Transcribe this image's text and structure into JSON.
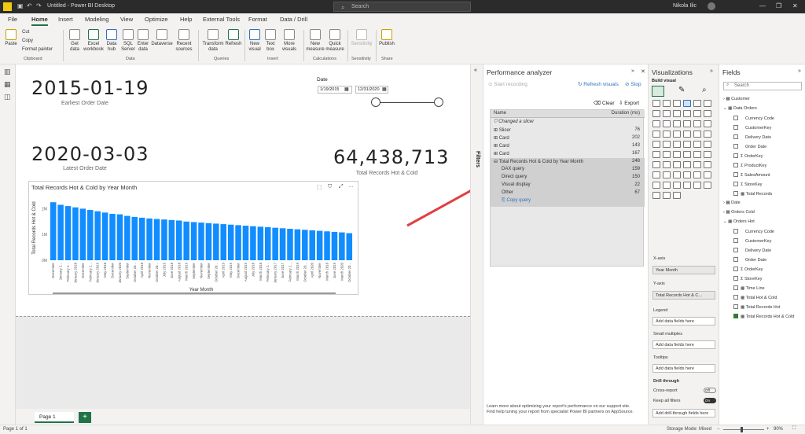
{
  "window": {
    "title": "Untitled - Power BI Desktop",
    "search": "Search",
    "user": "Nikola Ilic"
  },
  "tabs": [
    "File",
    "Home",
    "Insert",
    "Modeling",
    "View",
    "Optimize",
    "Help",
    "External Tools",
    "Format",
    "Data / Drill"
  ],
  "ribbon": {
    "clipboard": {
      "paste": "Paste",
      "cut": "Cut",
      "copy": "Copy",
      "format_painter": "Format painter",
      "group": "Clipboard"
    },
    "data": {
      "get_data": "Get data",
      "excel": "Excel workbook",
      "data_hub": "Data hub",
      "sql": "SQL Server",
      "enter": "Enter data",
      "dataverse": "Dataverse",
      "recent": "Recent sources",
      "group": "Data"
    },
    "queries": {
      "transform": "Transform data",
      "refresh": "Refresh",
      "group": "Queries"
    },
    "insert": {
      "new_visual": "New visual",
      "text_box": "Text box",
      "more_visuals": "More visuals",
      "group": "Insert"
    },
    "calculations": {
      "new_measure": "New measure",
      "quick_measure": "Quick measure",
      "group": "Calculations"
    },
    "sensitivity": {
      "label": "Sensitivity",
      "group": "Sensitivity"
    },
    "share": {
      "publish": "Publish",
      "group": "Share"
    }
  },
  "canvas": {
    "earliest": {
      "value": "2015-01-19",
      "label": "Earliest Order Date"
    },
    "latest": {
      "value": "2020-03-03",
      "label": "Latest Order Date"
    },
    "total": {
      "value": "64,438,713",
      "label": "Total Records Hot & Cold"
    },
    "slicer": {
      "title": "Date",
      "from": "1/19/2015",
      "to": "12/31/2020"
    }
  },
  "chart_data": {
    "type": "bar",
    "title": "Total Records Hot & Cold by Year Month",
    "xlabel": "Year Month",
    "ylabel": "Total Records Hot & Cold",
    "yticks": [
      "0M",
      "1M",
      "2M"
    ],
    "ylim": [
      0,
      2.5
    ],
    "categories": [
      "December",
      "January 2...",
      "February 2...",
      "January 2018",
      "December",
      "February 2...",
      "January 2019",
      "May 2018",
      "December",
      "January 2020",
      "September",
      "October 20...",
      "April 2018",
      "November",
      "October 20...",
      "July 2019",
      "June 2018",
      "August 2018",
      "March 2019",
      "September",
      "November",
      "September",
      "October 20...",
      "April 2019",
      "May 2019",
      "December",
      "August 2019",
      "July 2018",
      "March 2018",
      "February 2...",
      "January 2017",
      "June 2017",
      "February 2...",
      "March 2019",
      "October 20...",
      "April 2020",
      "November",
      "March 2018",
      "June 2019",
      "March 2020",
      "October 20..."
    ],
    "values": [
      2.25,
      2.15,
      2.1,
      2.05,
      2.0,
      1.95,
      1.9,
      1.85,
      1.8,
      1.78,
      1.72,
      1.68,
      1.65,
      1.62,
      1.6,
      1.58,
      1.56,
      1.54,
      1.5,
      1.48,
      1.46,
      1.44,
      1.42,
      1.4,
      1.38,
      1.36,
      1.34,
      1.32,
      1.3,
      1.28,
      1.26,
      1.24,
      1.22,
      1.2,
      1.18,
      1.16,
      1.14,
      1.12,
      1.1,
      1.08,
      1.05
    ]
  },
  "page": {
    "tab": "Page 1",
    "status": "Page 1 of 1",
    "storage": "Storage Mode: Mixed",
    "zoom": "90%"
  },
  "filters_label": "Filters",
  "perf": {
    "title": "Performance analyzer",
    "start": "Start recording",
    "refresh": "Refresh visuals",
    "stop": "Stop",
    "clear": "Clear",
    "export": "Export",
    "col_name": "Name",
    "col_dur": "Duration (ms)",
    "rows": [
      {
        "name": "Changed a slicer",
        "dur": ""
      },
      {
        "name": "Slicer",
        "dur": "76"
      },
      {
        "name": "Card",
        "dur": "202"
      },
      {
        "name": "Card",
        "dur": "143"
      },
      {
        "name": "Card",
        "dur": "167"
      },
      {
        "name": "Total Records Hot & Cold by Year Month",
        "dur": "248"
      },
      {
        "name": "DAX query",
        "dur": "159"
      },
      {
        "name": "Direct query",
        "dur": "150"
      },
      {
        "name": "Visual display",
        "dur": "22"
      },
      {
        "name": "Other",
        "dur": "67"
      },
      {
        "name": "Copy query",
        "dur": ""
      }
    ],
    "footer1": "Learn more about optimizing your report's performance on our support site.",
    "footer2": "Find help tuning your report from specialist Power BI partners on AppSource."
  },
  "viz": {
    "title": "Visualizations",
    "build": "Build visual",
    "xaxis": "X-axis",
    "xval": "Year Month",
    "yaxis": "Y-axis",
    "yval": "Total Records Hot & C...",
    "legend": "Legend",
    "legend_ph": "Add data fields here",
    "small": "Small multiples",
    "small_ph": "Add data fields here",
    "tooltips": "Tooltips",
    "tooltips_ph": "Add data fields here",
    "drill": "Drill through",
    "cross": "Cross-report",
    "cross_state": "Off",
    "keep": "Keep all filters",
    "keep_state": "On",
    "drill_ph": "Add drill-through fields here"
  },
  "fields": {
    "title": "Fields",
    "search": "Search",
    "items": [
      {
        "t": "Customer",
        "lvl": 0,
        "k": "tbl"
      },
      {
        "t": "Data Orders",
        "lvl": 0,
        "k": "tbl"
      },
      {
        "t": "Currency Code",
        "lvl": 1,
        "k": "f"
      },
      {
        "t": "CustomerKey",
        "lvl": 1,
        "k": "f"
      },
      {
        "t": "Delivery Date",
        "lvl": 1,
        "k": "f"
      },
      {
        "t": "Order Date",
        "lvl": 1,
        "k": "f"
      },
      {
        "t": "OrderKey",
        "lvl": 1,
        "k": "s"
      },
      {
        "t": "ProductKey",
        "lvl": 1,
        "k": "s"
      },
      {
        "t": "SalesAmount",
        "lvl": 1,
        "k": "s"
      },
      {
        "t": "StoreKey",
        "lvl": 1,
        "k": "s"
      },
      {
        "t": "Total Records",
        "lvl": 1,
        "k": "m"
      },
      {
        "t": "Date",
        "lvl": 0,
        "k": "tbl"
      },
      {
        "t": "Orders Cold",
        "lvl": 0,
        "k": "tbl"
      },
      {
        "t": "Orders Hot",
        "lvl": 0,
        "k": "tbl"
      },
      {
        "t": "Currency Code",
        "lvl": 1,
        "k": "f"
      },
      {
        "t": "CustomerKey",
        "lvl": 1,
        "k": "f"
      },
      {
        "t": "Delivery Date",
        "lvl": 1,
        "k": "f"
      },
      {
        "t": "Order Date",
        "lvl": 1,
        "k": "f"
      },
      {
        "t": "OrderKey",
        "lvl": 1,
        "k": "s"
      },
      {
        "t": "StoreKey",
        "lvl": 1,
        "k": "s"
      },
      {
        "t": "Time Line",
        "lvl": 1,
        "k": "m"
      },
      {
        "t": "Total Hot & Cold",
        "lvl": 1,
        "k": "m"
      },
      {
        "t": "Total Records Hot",
        "lvl": 1,
        "k": "m"
      },
      {
        "t": "Total Records Hot & Cold",
        "lvl": 1,
        "k": "mc"
      }
    ]
  }
}
